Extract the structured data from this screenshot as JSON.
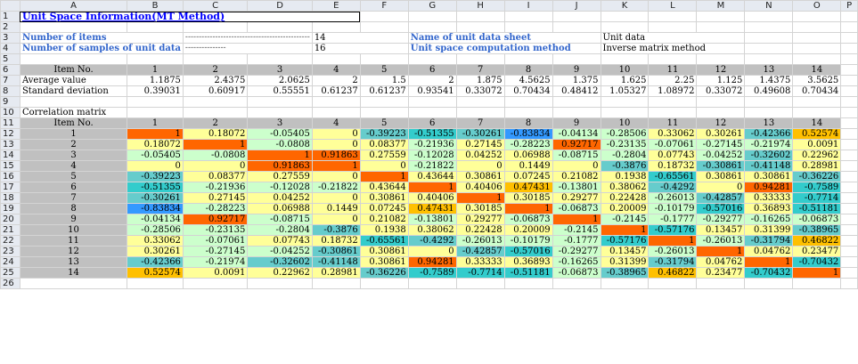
{
  "columns": [
    "A",
    "B",
    "C",
    "D",
    "E",
    "F",
    "G",
    "H",
    "I",
    "J",
    "K",
    "L",
    "M",
    "N",
    "O",
    "P"
  ],
  "title": "Unit Space Information(MT Method)",
  "info": {
    "num_items_label": "Number of items",
    "num_items_dots": "----------------------------------------------",
    "num_items_value": "14",
    "num_samples_label": "Number of samples of unit data",
    "num_samples_dots": "---------------",
    "num_samples_value": "16",
    "sheet_name_label": "Name of unit data sheet",
    "sheet_name_dots": "------------",
    "sheet_name_value": "Unit data",
    "method_label": "Unit space computation method",
    "method_dots": "----",
    "method_value": "Inverse matrix method"
  },
  "item_header": {
    "label": "Item No.",
    "numbers": [
      "1",
      "2",
      "3",
      "4",
      "5",
      "6",
      "7",
      "8",
      "9",
      "10",
      "11",
      "12",
      "13",
      "14"
    ]
  },
  "average": {
    "label": "Average value",
    "values": [
      "1.1875",
      "2.4375",
      "2.0625",
      "2",
      "1.5",
      "2",
      "1.875",
      "4.5625",
      "1.375",
      "1.625",
      "2.25",
      "1.125",
      "1.4375",
      "3.5625"
    ]
  },
  "stddev": {
    "label": "Standard deviation",
    "values": [
      "0.39031",
      "0.60917",
      "0.55551",
      "0.61237",
      "0.61237",
      "0.93541",
      "0.33072",
      "0.70434",
      "0.48412",
      "1.05327",
      "1.08972",
      "0.33072",
      "0.49608",
      "0.70434"
    ]
  },
  "correlation": {
    "title": "Correlation matrix",
    "header_label": "Item No.",
    "rows": [
      {
        "label": "1",
        "values": [
          "1",
          "0.18072",
          "-0.05405",
          "0",
          "-0.39223",
          "-0.51355",
          "-0.30261",
          "-0.83834",
          "-0.04134",
          "-0.28506",
          "0.33062",
          "0.30261",
          "-0.42366",
          "0.52574"
        ]
      },
      {
        "label": "2",
        "values": [
          "0.18072",
          "1",
          "-0.0808",
          "0",
          "0.08377",
          "-0.21936",
          "0.27145",
          "-0.28223",
          "0.92717",
          "-0.23135",
          "-0.07061",
          "-0.27145",
          "-0.21974",
          "0.0091"
        ]
      },
      {
        "label": "3",
        "values": [
          "-0.05405",
          "-0.0808",
          "1",
          "0.91863",
          "0.27559",
          "-0.12028",
          "0.04252",
          "0.06988",
          "-0.08715",
          "-0.2804",
          "0.07743",
          "-0.04252",
          "-0.32602",
          "0.22962"
        ]
      },
      {
        "label": "4",
        "values": [
          "0",
          "0",
          "0.91863",
          "1",
          "0",
          "-0.21822",
          "0",
          "0.1449",
          "0",
          "-0.3876",
          "0.18732",
          "-0.30861",
          "-0.41148",
          "0.28981"
        ]
      },
      {
        "label": "5",
        "values": [
          "-0.39223",
          "0.08377",
          "0.27559",
          "0",
          "1",
          "0.43644",
          "0.30861",
          "0.07245",
          "0.21082",
          "0.1938",
          "-0.65561",
          "0.30861",
          "0.30861",
          "-0.36226"
        ]
      },
      {
        "label": "6",
        "values": [
          "-0.51355",
          "-0.21936",
          "-0.12028",
          "-0.21822",
          "0.43644",
          "1",
          "0.40406",
          "0.47431",
          "-0.13801",
          "0.38062",
          "-0.4292",
          "0",
          "0.94281",
          "-0.7589"
        ]
      },
      {
        "label": "7",
        "values": [
          "-0.30261",
          "0.27145",
          "0.04252",
          "0",
          "0.30861",
          "0.40406",
          "1",
          "0.30185",
          "0.29277",
          "0.22428",
          "-0.26013",
          "-0.42857",
          "0.33333",
          "-0.7714"
        ]
      },
      {
        "label": "8",
        "values": [
          "-0.83834",
          "-0.28223",
          "0.06988",
          "0.1449",
          "0.07245",
          "0.47431",
          "0.30185",
          "1",
          "-0.06873",
          "0.20009",
          "-0.10179",
          "-0.57016",
          "0.36893",
          "-0.51181"
        ]
      },
      {
        "label": "9",
        "values": [
          "-0.04134",
          "0.92717",
          "-0.08715",
          "0",
          "0.21082",
          "-0.13801",
          "0.29277",
          "-0.06873",
          "1",
          "-0.2145",
          "-0.1777",
          "-0.29277",
          "-0.16265",
          "-0.06873"
        ]
      },
      {
        "label": "10",
        "values": [
          "-0.28506",
          "-0.23135",
          "-0.2804",
          "-0.3876",
          "0.1938",
          "0.38062",
          "0.22428",
          "0.20009",
          "-0.2145",
          "1",
          "-0.57176",
          "0.13457",
          "0.31399",
          "-0.38965"
        ]
      },
      {
        "label": "11",
        "values": [
          "0.33062",
          "-0.07061",
          "0.07743",
          "0.18732",
          "-0.65561",
          "-0.4292",
          "-0.26013",
          "-0.10179",
          "-0.1777",
          "-0.57176",
          "1",
          "-0.26013",
          "-0.31794",
          "0.46822"
        ]
      },
      {
        "label": "12",
        "values": [
          "0.30261",
          "-0.27145",
          "-0.04252",
          "-0.30861",
          "0.30861",
          "0",
          "-0.42857",
          "-0.57016",
          "-0.29277",
          "0.13457",
          "-0.26013",
          "1",
          "0.04762",
          "0.23477"
        ]
      },
      {
        "label": "13",
        "values": [
          "-0.42366",
          "-0.21974",
          "-0.32602",
          "-0.41148",
          "0.30861",
          "0.94281",
          "0.33333",
          "0.36893",
          "-0.16265",
          "0.31399",
          "-0.31794",
          "0.04762",
          "1",
          "-0.70432"
        ]
      },
      {
        "label": "14",
        "values": [
          "0.52574",
          "0.0091",
          "0.22962",
          "0.28981",
          "-0.36226",
          "-0.7589",
          "-0.7714",
          "-0.51181",
          "-0.06873",
          "-0.38965",
          "0.46822",
          "0.23477",
          "-0.70432",
          "1"
        ]
      }
    ]
  },
  "colors": {
    "very_high": "#ff6600",
    "high": "#ffc000",
    "mid_high": "#ffff99",
    "mid_low": "#ccffcc",
    "low": "#66cccc",
    "very_low": "#33cccc",
    "min": "#3399ff",
    "header_gray": "#c0c0c0",
    "title_blue": "#0000ff",
    "label_blue": "#3366cc"
  }
}
